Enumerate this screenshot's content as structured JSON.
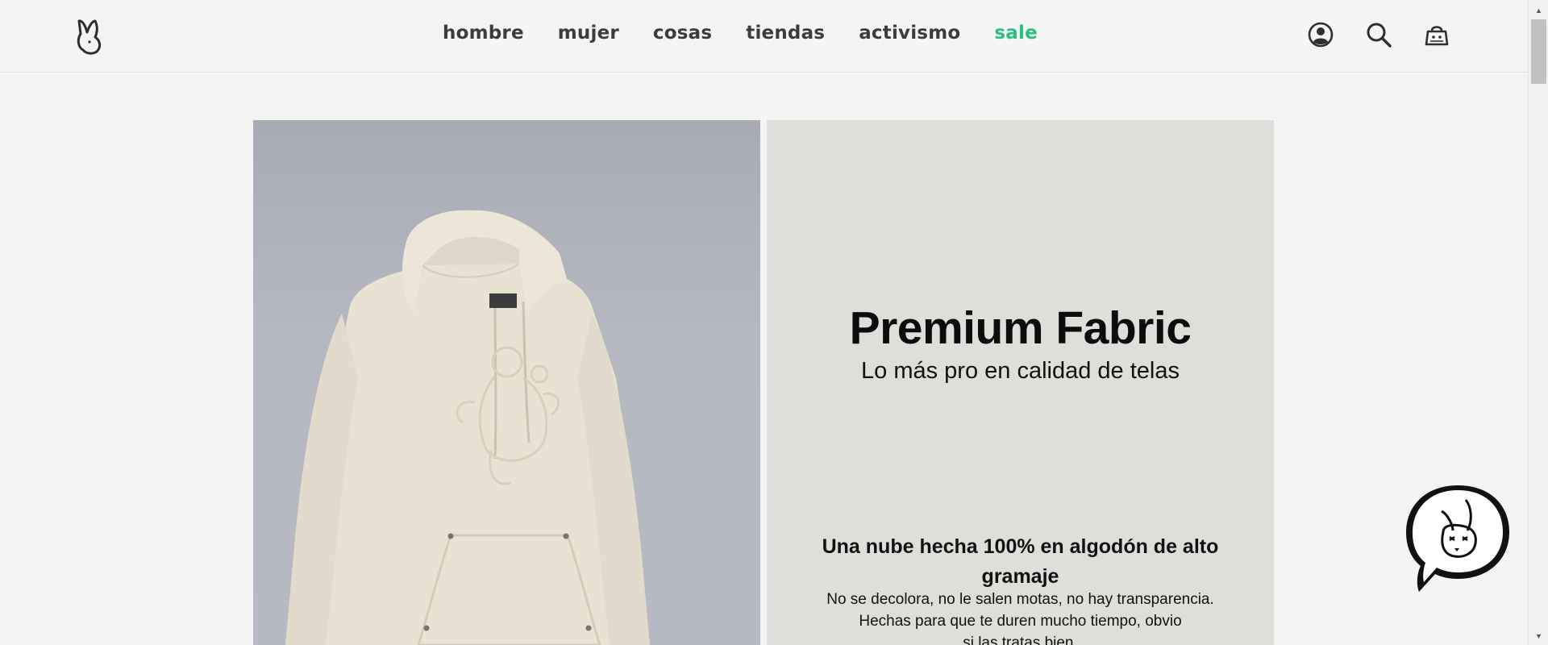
{
  "header": {
    "logo_icon": "bunny-logo-icon",
    "nav": [
      {
        "label": "hombre"
      },
      {
        "label": "mujer"
      },
      {
        "label": "cosas"
      },
      {
        "label": "tiendas"
      },
      {
        "label": "activismo"
      },
      {
        "label": "sale"
      }
    ],
    "icons": [
      "account-icon",
      "search-icon",
      "cart-icon"
    ],
    "sale_color": "#2dbf7e"
  },
  "hero": {
    "image_icon": "beige-hoodie-product-image",
    "title": "Premium Fabric",
    "subtitle": "Lo más pro en calidad de telas",
    "heading": "Una nube hecha 100% en algodón de alto gramaje",
    "body_line1": "No se decolora, no le salen motas, no hay transparencia.",
    "body_line2": "Hechas para que te duren mucho tiempo, obvio",
    "body_line3": "si las tratas bien."
  },
  "chat": {
    "icon": "bunny-chat-bubble-icon"
  }
}
